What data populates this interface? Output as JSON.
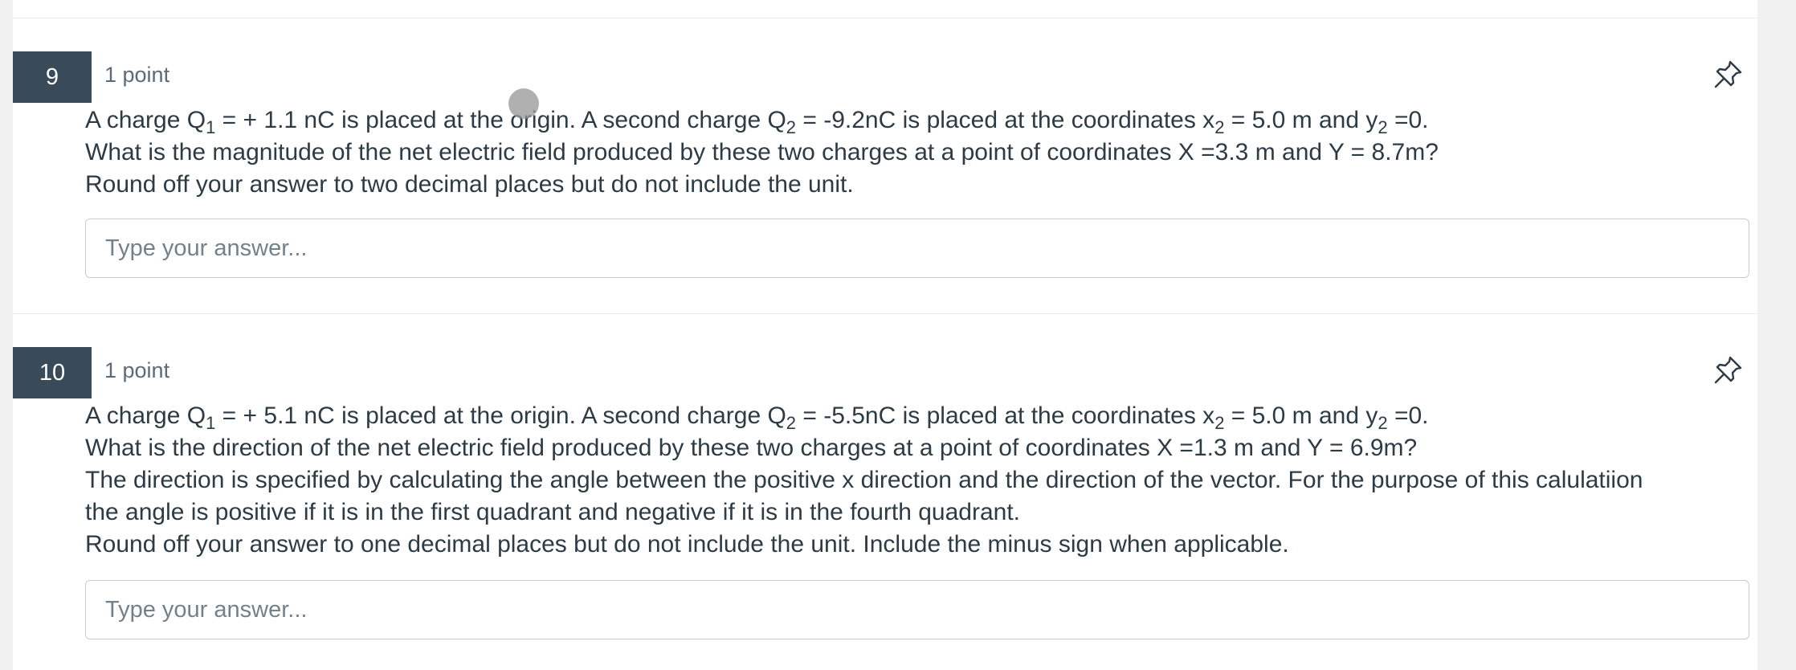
{
  "colors": {
    "number_badge_bg": "#394b58",
    "text": "#2d3b45",
    "muted_text": "#5b6b77",
    "input_border": "#c7cdd1",
    "page_bg": "#f1f1f1"
  },
  "questions": [
    {
      "number": "9",
      "points": "1 point",
      "pin_icon": "pin-icon",
      "lines": [
        [
          {
            "t": "A charge Q"
          },
          {
            "sub": "1"
          },
          {
            "t": " = + 1.1 nC is placed at the origin. A second charge Q"
          },
          {
            "sub": "2"
          },
          {
            "t": " = -9.2nC is placed at the coordinates x"
          },
          {
            "sub": "2"
          },
          {
            "t": " = 5.0 m and y"
          },
          {
            "sub": "2"
          },
          {
            "t": " =0."
          }
        ],
        [
          {
            "t": "What is the magnitude of the net electric field produced by these two charges at a point of coordinates X =3.3 m and Y = 8.7m?"
          }
        ],
        [
          {
            "t": "Round off your answer to two decimal places but do not include the unit."
          }
        ]
      ],
      "answer_value": "",
      "answer_placeholder": "Type your answer..."
    },
    {
      "number": "10",
      "points": "1 point",
      "pin_icon": "pin-icon",
      "lines": [
        [
          {
            "t": "A charge Q"
          },
          {
            "sub": "1"
          },
          {
            "t": " = + 5.1 nC is placed at the origin. A second charge Q"
          },
          {
            "sub": "2"
          },
          {
            "t": " = -5.5nC is placed at the coordinates x"
          },
          {
            "sub": "2"
          },
          {
            "t": " = 5.0 m and y"
          },
          {
            "sub": "2"
          },
          {
            "t": " =0."
          }
        ],
        [
          {
            "t": "What is the direction of the net electric field produced by these two charges at a point of coordinates X =1.3 m and Y = 6.9m?"
          }
        ],
        [
          {
            "t": "The direction is specified by calculating the angle between the positive x direction and the direction of the vector.  For the purpose of this calulatiion"
          }
        ],
        [
          {
            "t": "the angle is positive if it is in the first quadrant and negative if it is in the fourth quadrant."
          }
        ],
        [
          {
            "t": "Round off your answer to one decimal places but do not include the unit. Include the minus sign when applicable."
          }
        ]
      ],
      "answer_value": "",
      "answer_placeholder": "Type your answer..."
    }
  ]
}
